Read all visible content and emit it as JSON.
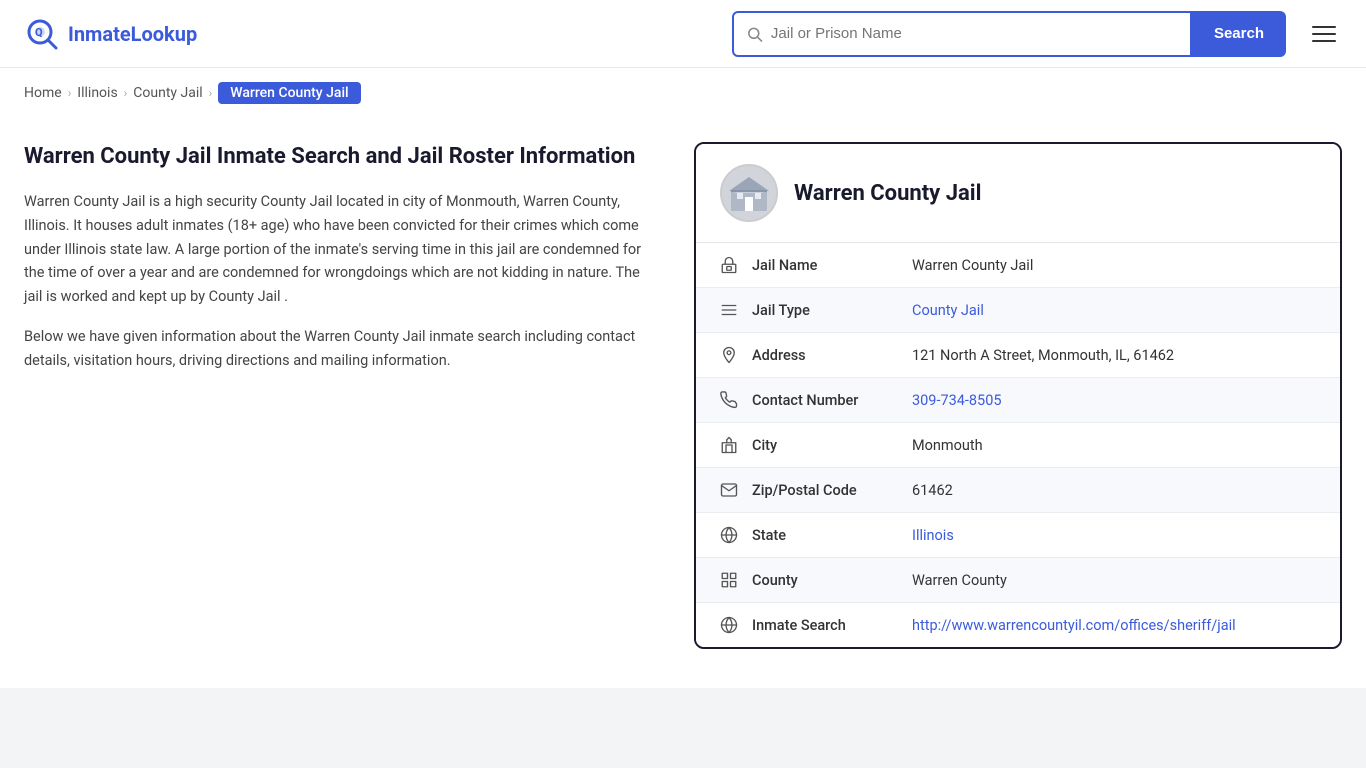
{
  "header": {
    "logo_brand": "InmateLookup",
    "logo_brand_prefix": "Inmate",
    "logo_brand_suffix": "Lookup",
    "search_placeholder": "Jail or Prison Name",
    "search_button_label": "Search"
  },
  "breadcrumb": {
    "items": [
      {
        "label": "Home",
        "href": "#"
      },
      {
        "label": "Illinois",
        "href": "#"
      },
      {
        "label": "County Jail",
        "href": "#"
      },
      {
        "label": "Warren County Jail",
        "active": true
      }
    ]
  },
  "left_panel": {
    "title": "Warren County Jail Inmate Search and Jail Roster Information",
    "description1": "Warren County Jail is a high security County Jail located in city of Monmouth, Warren County, Illinois. It houses adult inmates (18+ age) who have been convicted for their crimes which come under Illinois state law. A large portion of the inmate's serving time in this jail are condemned for the time of over a year and are condemned for wrongdoings which are not kidding in nature. The jail is worked and kept up by County Jail .",
    "description2": "Below we have given information about the Warren County Jail inmate search including contact details, visitation hours, driving directions and mailing information."
  },
  "info_card": {
    "jail_name_header": "Warren County Jail",
    "rows": [
      {
        "icon": "jail-icon",
        "label": "Jail Name",
        "value": "Warren County Jail",
        "link": null
      },
      {
        "icon": "type-icon",
        "label": "Jail Type",
        "value": "County Jail",
        "link": "#"
      },
      {
        "icon": "address-icon",
        "label": "Address",
        "value": "121 North A Street, Monmouth, IL, 61462",
        "link": null
      },
      {
        "icon": "phone-icon",
        "label": "Contact Number",
        "value": "309-734-8505",
        "link": "tel:309-734-8505"
      },
      {
        "icon": "city-icon",
        "label": "City",
        "value": "Monmouth",
        "link": null
      },
      {
        "icon": "zip-icon",
        "label": "Zip/Postal Code",
        "value": "61462",
        "link": null
      },
      {
        "icon": "state-icon",
        "label": "State",
        "value": "Illinois",
        "link": "#"
      },
      {
        "icon": "county-icon",
        "label": "County",
        "value": "Warren County",
        "link": null
      },
      {
        "icon": "web-icon",
        "label": "Inmate Search",
        "value": "http://www.warrencountyil.com/offices/sheriff/jail",
        "link": "http://www.warrencountyil.com/offices/sheriff/jail"
      }
    ]
  }
}
